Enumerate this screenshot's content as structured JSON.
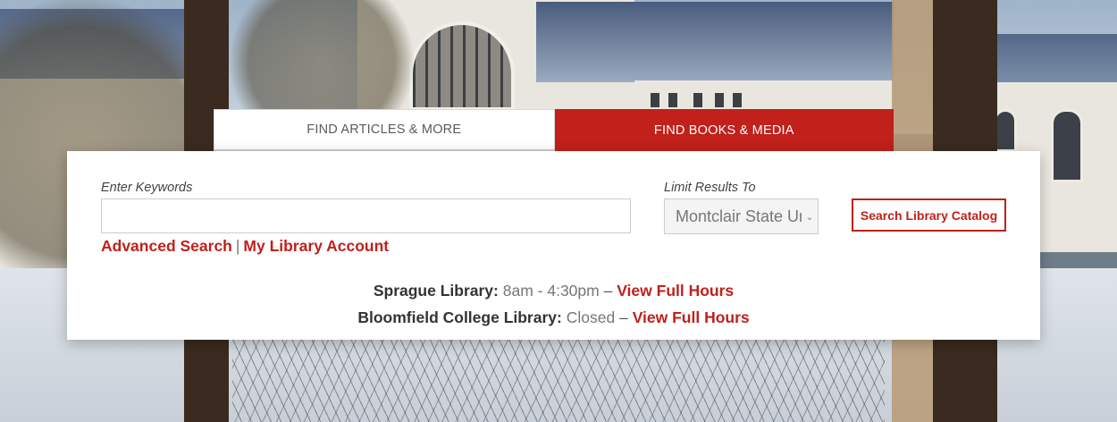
{
  "tabs": [
    {
      "label": "FIND ARTICLES & MORE",
      "active": false
    },
    {
      "label": "FIND BOOKS & MEDIA",
      "active": true
    }
  ],
  "search": {
    "keywords_label": "Enter Keywords",
    "keywords_value": "",
    "keywords_placeholder": "",
    "limit_label": "Limit Results To",
    "limit_selected": "Montclair State University",
    "submit_label": "Search Library Catalog"
  },
  "links": {
    "advanced_search": "Advanced Search",
    "separator": "|",
    "my_account": "My Library Account"
  },
  "hours": [
    {
      "library": "Sprague Library:",
      "time": "8am - 4:30pm",
      "dash": "–",
      "link": "View Full Hours"
    },
    {
      "library": "Bloomfield College Library:",
      "time": "Closed",
      "dash": "–",
      "link": "View Full Hours"
    }
  ],
  "colors": {
    "accent": "#c1201b",
    "panel_bg": "#ffffff",
    "inactive_tab_text": "#5b5b5b"
  },
  "icons": {
    "select_arrow": "chevron-down-icon"
  }
}
